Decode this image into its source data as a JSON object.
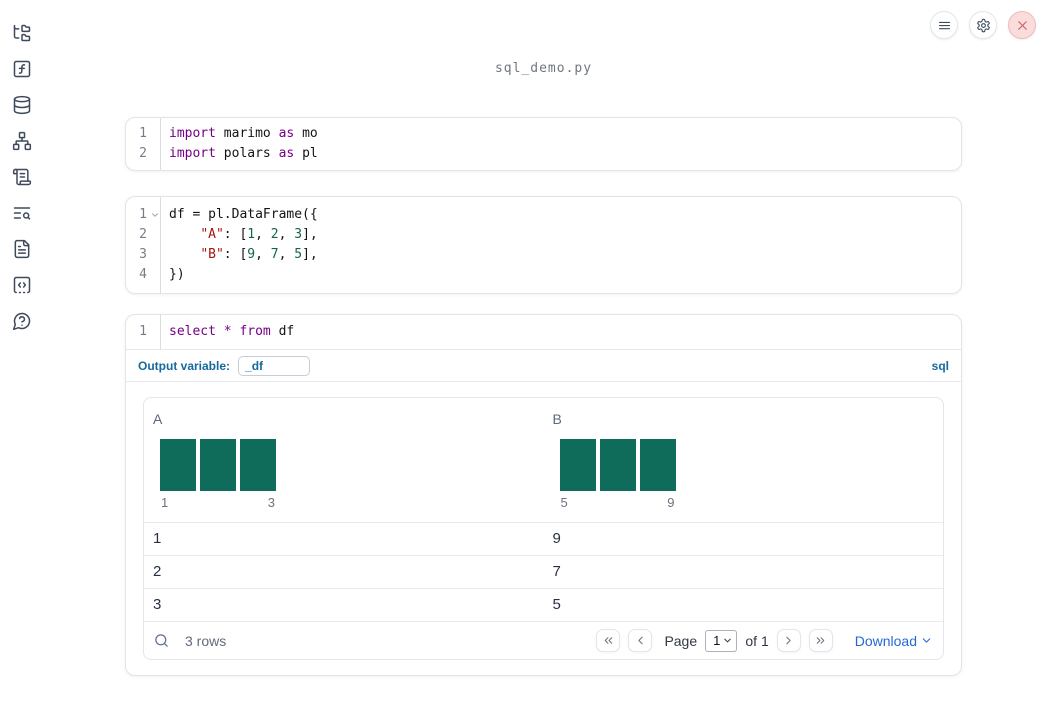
{
  "notebook": {
    "title": "sql_demo.py"
  },
  "topbar": {
    "buttons": [
      {
        "name": "notebook-menu",
        "icon": "menu-icon"
      },
      {
        "name": "settings",
        "icon": "gear-icon"
      },
      {
        "name": "shutdown",
        "icon": "close-icon"
      }
    ]
  },
  "sidebar": {
    "items": [
      {
        "name": "file-explorer",
        "icon": "folder-tree-icon"
      },
      {
        "name": "variables",
        "icon": "function-square-icon"
      },
      {
        "name": "data-sources",
        "icon": "database-icon"
      },
      {
        "name": "dependency-graph",
        "icon": "network-icon"
      },
      {
        "name": "logs",
        "icon": "scroll-text-icon"
      },
      {
        "name": "table-of-contents",
        "icon": "text-search-icon"
      },
      {
        "name": "documentation",
        "icon": "file-text-icon"
      },
      {
        "name": "snippets",
        "icon": "code-snippet-icon"
      },
      {
        "name": "help",
        "icon": "help-chat-icon"
      }
    ]
  },
  "cells": [
    {
      "id": "imports-cell",
      "lines": [
        {
          "num": "1",
          "tokens": [
            {
              "t": "import",
              "c": "keyword"
            },
            {
              "t": " marimo ",
              "c": "plain"
            },
            {
              "t": "as",
              "c": "keyword"
            },
            {
              "t": " mo",
              "c": "plain"
            }
          ]
        },
        {
          "num": "2",
          "tokens": [
            {
              "t": "import",
              "c": "keyword"
            },
            {
              "t": " polars ",
              "c": "plain"
            },
            {
              "t": "as",
              "c": "keyword"
            },
            {
              "t": " pl",
              "c": "plain"
            }
          ]
        }
      ]
    },
    {
      "id": "dataframe-cell",
      "lines": [
        {
          "num": "1",
          "foldable": true,
          "tokens": [
            {
              "t": "df = pl.DataFrame({",
              "c": "plain"
            }
          ]
        },
        {
          "num": "2",
          "tokens": [
            {
              "t": "    ",
              "c": "plain"
            },
            {
              "t": "\"A\"",
              "c": "string"
            },
            {
              "t": ": [",
              "c": "plain"
            },
            {
              "t": "1",
              "c": "number"
            },
            {
              "t": ", ",
              "c": "plain"
            },
            {
              "t": "2",
              "c": "number"
            },
            {
              "t": ", ",
              "c": "plain"
            },
            {
              "t": "3",
              "c": "number"
            },
            {
              "t": "],",
              "c": "plain"
            }
          ]
        },
        {
          "num": "3",
          "tokens": [
            {
              "t": "    ",
              "c": "plain"
            },
            {
              "t": "\"B\"",
              "c": "string"
            },
            {
              "t": ": [",
              "c": "plain"
            },
            {
              "t": "9",
              "c": "number"
            },
            {
              "t": ", ",
              "c": "plain"
            },
            {
              "t": "7",
              "c": "number"
            },
            {
              "t": ", ",
              "c": "plain"
            },
            {
              "t": "5",
              "c": "number"
            },
            {
              "t": "],",
              "c": "plain"
            }
          ]
        },
        {
          "num": "4",
          "tokens": [
            {
              "t": "})",
              "c": "plain"
            }
          ]
        }
      ]
    },
    {
      "id": "sql-cell",
      "lines": [
        {
          "num": "1",
          "tokens": [
            {
              "t": "select",
              "c": "keyword"
            },
            {
              "t": " ",
              "c": "plain"
            },
            {
              "t": "*",
              "c": "keyword"
            },
            {
              "t": " ",
              "c": "plain"
            },
            {
              "t": "from",
              "c": "keyword"
            },
            {
              "t": " df",
              "c": "plain"
            }
          ]
        }
      ]
    }
  ],
  "sql_cell_footer": {
    "output_variable_label": "Output variable:",
    "output_variable_value": "_df",
    "language_label": "sql"
  },
  "table": {
    "columns": [
      {
        "name": "A",
        "histogram": {
          "bar_count": 3,
          "min_label": "1",
          "max_label": "3",
          "values": [
            1,
            2,
            3
          ]
        }
      },
      {
        "name": "B",
        "histogram": {
          "bar_count": 3,
          "min_label": "5",
          "max_label": "9",
          "values": [
            9,
            7,
            5
          ]
        }
      }
    ],
    "rows": [
      [
        "1",
        "9"
      ],
      [
        "2",
        "7"
      ],
      [
        "3",
        "5"
      ]
    ],
    "footer": {
      "row_count": "3 rows",
      "page_label": "Page",
      "page_value": "1",
      "of_label": "of 1",
      "download_label": "Download"
    }
  },
  "colors": {
    "histogram_bar": "#106c5a",
    "sql_accent": "#15699e",
    "link_blue": "#2667d9",
    "code_keyword": "#770088",
    "code_string": "#aa1111",
    "code_number": "#116644"
  }
}
